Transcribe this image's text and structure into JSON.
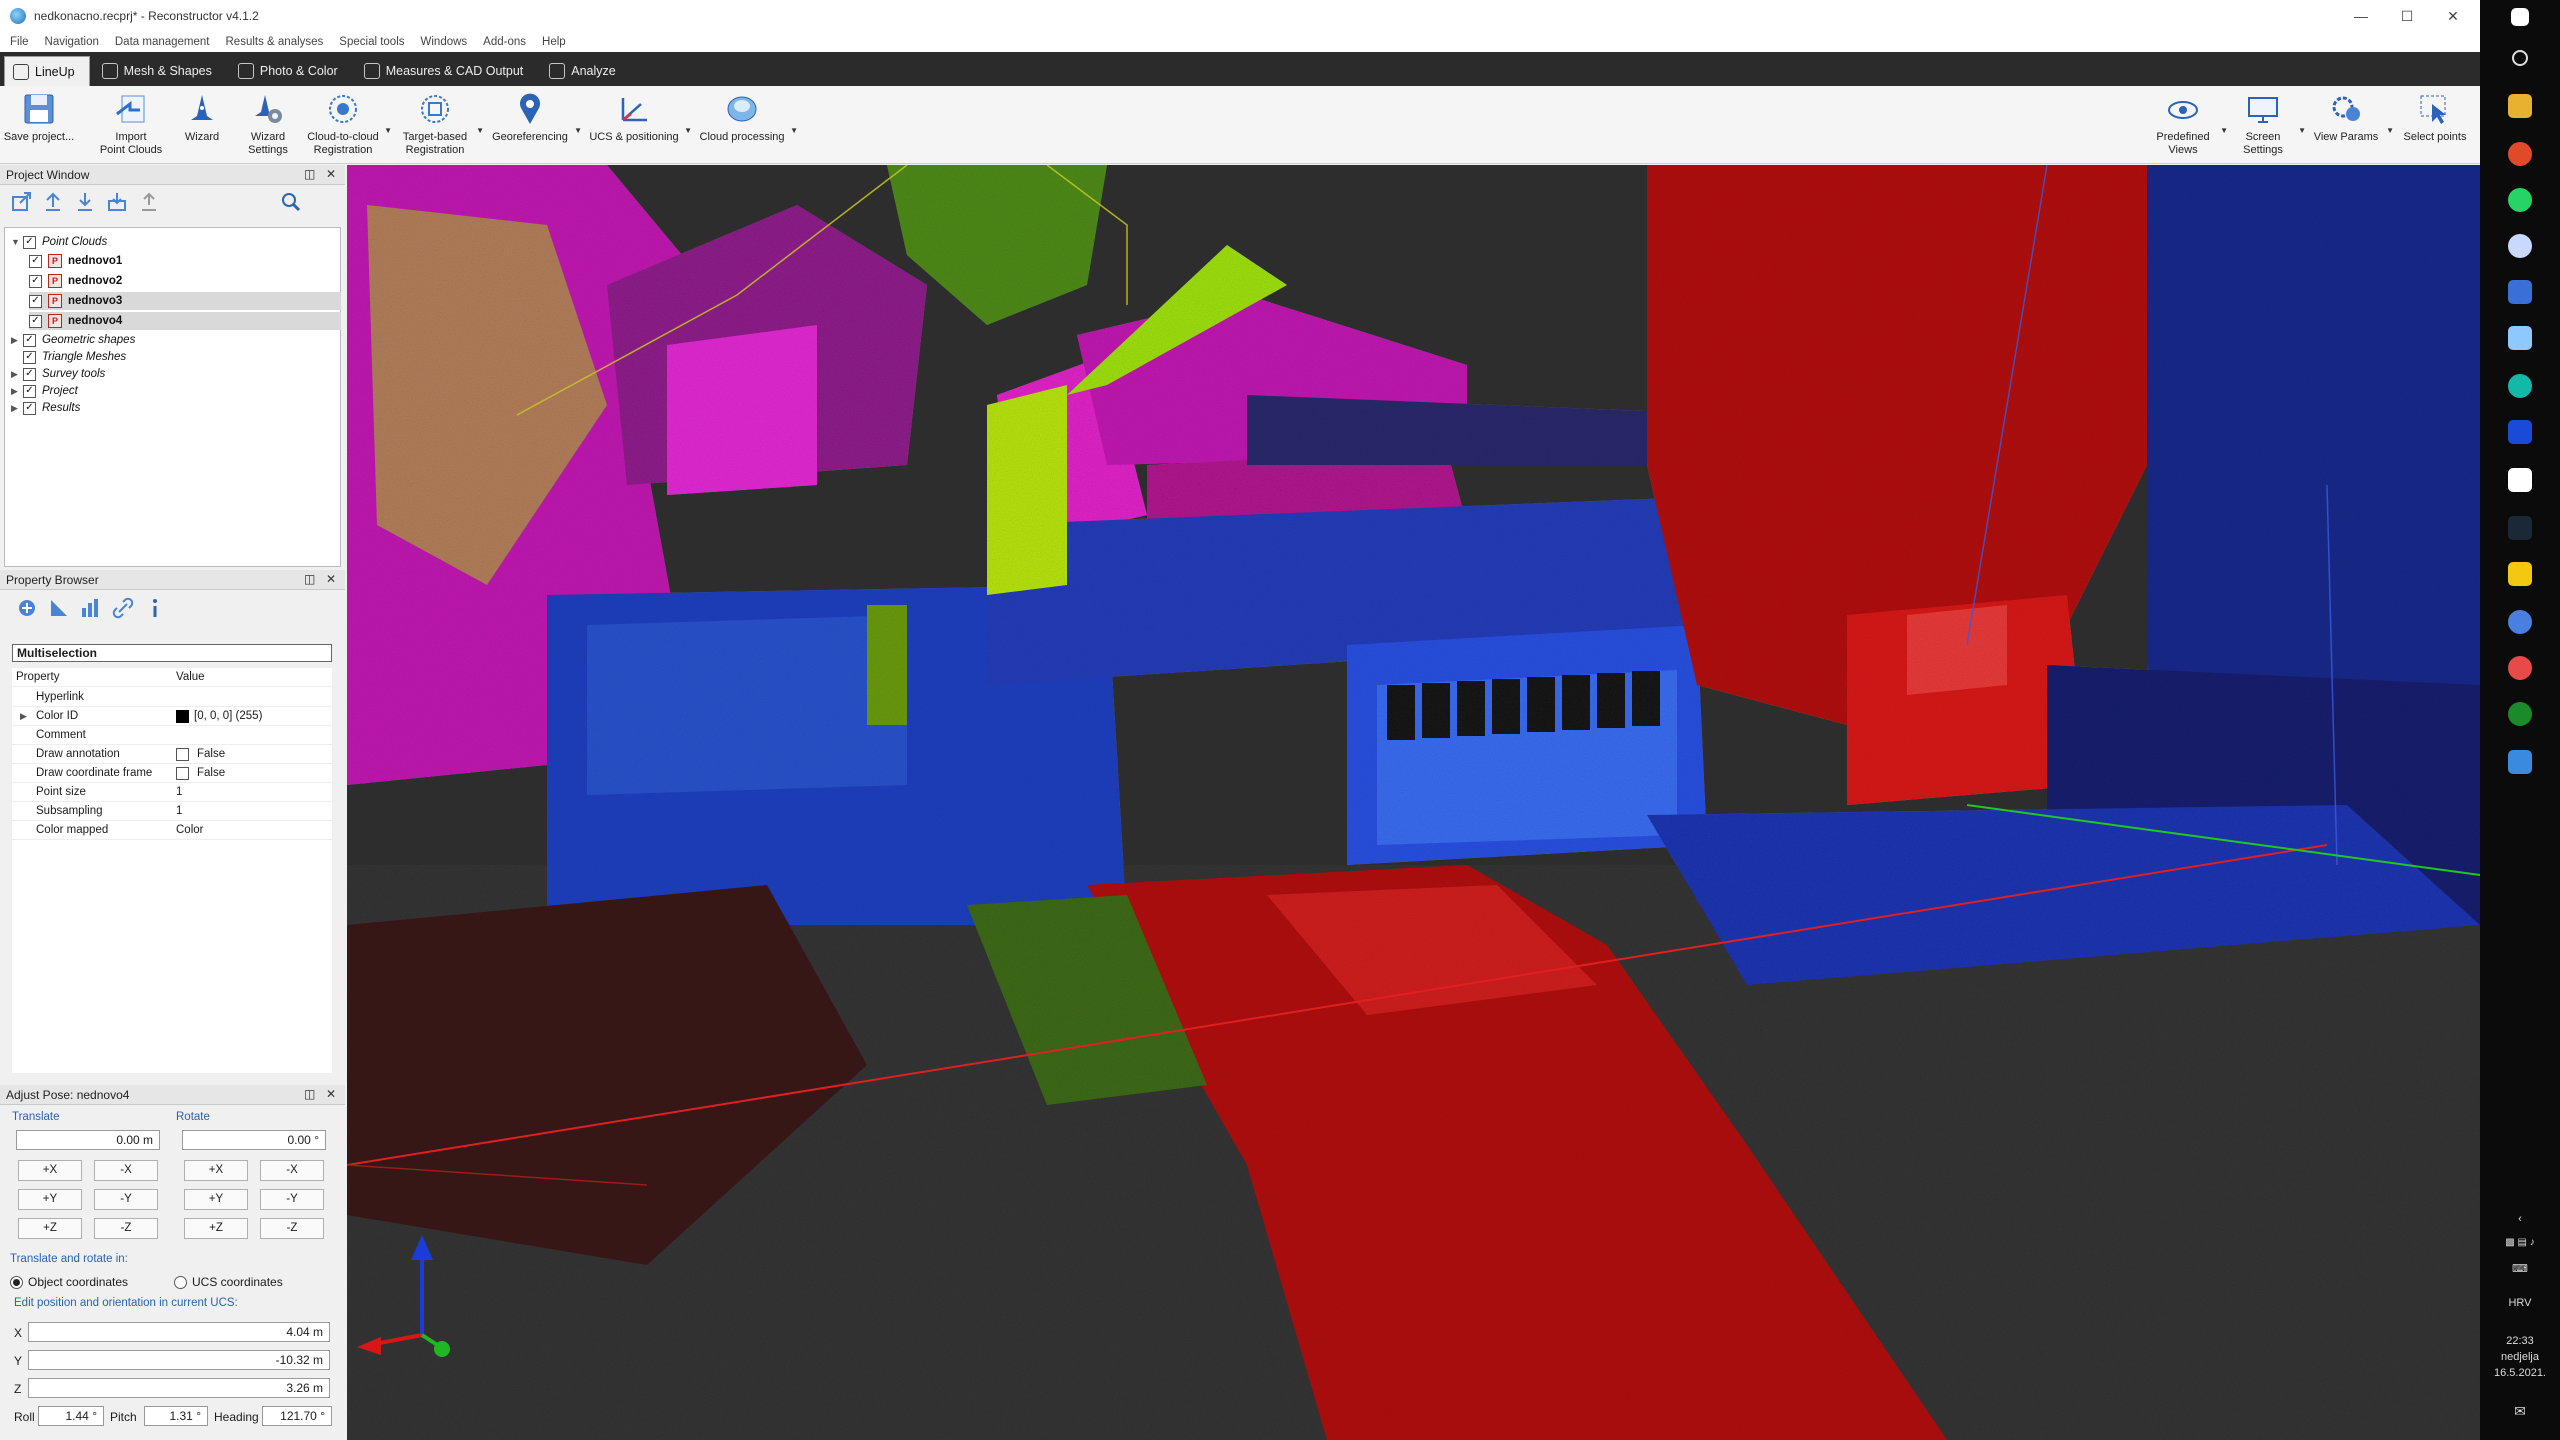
{
  "window": {
    "title": "nedkonacno.recprj* - Reconstructor v4.1.2"
  },
  "menu": [
    "File",
    "Navigation",
    "Data management",
    "Results & analyses",
    "Special tools",
    "Windows",
    "Add-ons",
    "Help"
  ],
  "tabs": [
    {
      "label": "LineUp",
      "icon": "lineup-icon"
    },
    {
      "label": "Mesh & Shapes",
      "icon": "mesh-icon"
    },
    {
      "label": "Photo & Color",
      "icon": "photo-icon"
    },
    {
      "label": "Measures & CAD Output",
      "icon": "measures-icon"
    },
    {
      "label": "Analyze",
      "icon": "analyze-icon"
    }
  ],
  "ribbon": {
    "save": "Save project...",
    "import": "Import\nPoint Clouds",
    "wizard": "Wizard",
    "wizard_settings": "Wizard\nSettings",
    "c2c": "Cloud-to-cloud\nRegistration",
    "target": "Target-based\nRegistration",
    "georef": "Georeferencing",
    "ucs": "UCS & positioning",
    "cloudproc": "Cloud processing",
    "predef": "Predefined\nViews",
    "screen": "Screen\nSettings",
    "viewparams": "View Params",
    "selectpts": "Select points"
  },
  "project_window": {
    "title": "Project Window",
    "tree": [
      {
        "label": "Point Clouds",
        "italic": true,
        "expanded": true
      },
      {
        "label": "nednovo1",
        "bold": true
      },
      {
        "label": "nednovo2",
        "bold": true
      },
      {
        "label": "nednovo3",
        "bold": true
      },
      {
        "label": "nednovo4",
        "bold": true
      },
      {
        "label": "Geometric shapes",
        "italic": true
      },
      {
        "label": "Triangle Meshes",
        "italic": true
      },
      {
        "label": "Survey tools",
        "italic": true
      },
      {
        "label": "Project",
        "italic": true
      },
      {
        "label": "Results",
        "italic": true
      }
    ]
  },
  "property_browser": {
    "title": "Property Browser",
    "selection": "Multiselection",
    "header": {
      "property": "Property",
      "value": "Value"
    },
    "rows": [
      {
        "k": "Hyperlink",
        "v": ""
      },
      {
        "k": "Color ID",
        "v": "[0, 0, 0] (255)"
      },
      {
        "k": "Comment",
        "v": ""
      },
      {
        "k": "Draw annotation",
        "v": "False"
      },
      {
        "k": "Draw coordinate frame",
        "v": "False"
      },
      {
        "k": "Point size",
        "v": "1"
      },
      {
        "k": "Subsampling",
        "v": "1"
      },
      {
        "k": "Color mapped",
        "v": "Color"
      }
    ]
  },
  "adjust_pose": {
    "title": "Adjust Pose: nednovo4",
    "translate_label": "Translate",
    "rotate_label": "Rotate",
    "translate_value": "0.00 m",
    "rotate_value": "0.00 °",
    "buttons": [
      "+X",
      "-X",
      "+Y",
      "-Y",
      "+Z",
      "-Z"
    ],
    "in_label": "Translate and rotate in:",
    "object_coords": "Object coordinates",
    "ucs_coords": "UCS coordinates",
    "edit_label": "Edit position and orientation in current UCS:",
    "x_label": "X",
    "x": "4.04 m",
    "y_label": "Y",
    "y": "-10.32 m",
    "z_label": "Z",
    "z": "3.26 m",
    "roll_label": "Roll",
    "roll": "1.44 °",
    "pitch_label": "Pitch",
    "pitch": "1.31 °",
    "heading_label": "Heading",
    "heading": "121.70 °"
  },
  "taskbar": {
    "lang": "HRV",
    "time": "22:33",
    "day": "nedjelja",
    "date": "16.5.2021."
  },
  "colors": {
    "cloud_magenta": "#e020c8",
    "cloud_green": "#9fe010",
    "cloud_blue": "#1a3cd8",
    "cloud_red": "#d81616",
    "viewport_bg": "#2d2d2d"
  }
}
